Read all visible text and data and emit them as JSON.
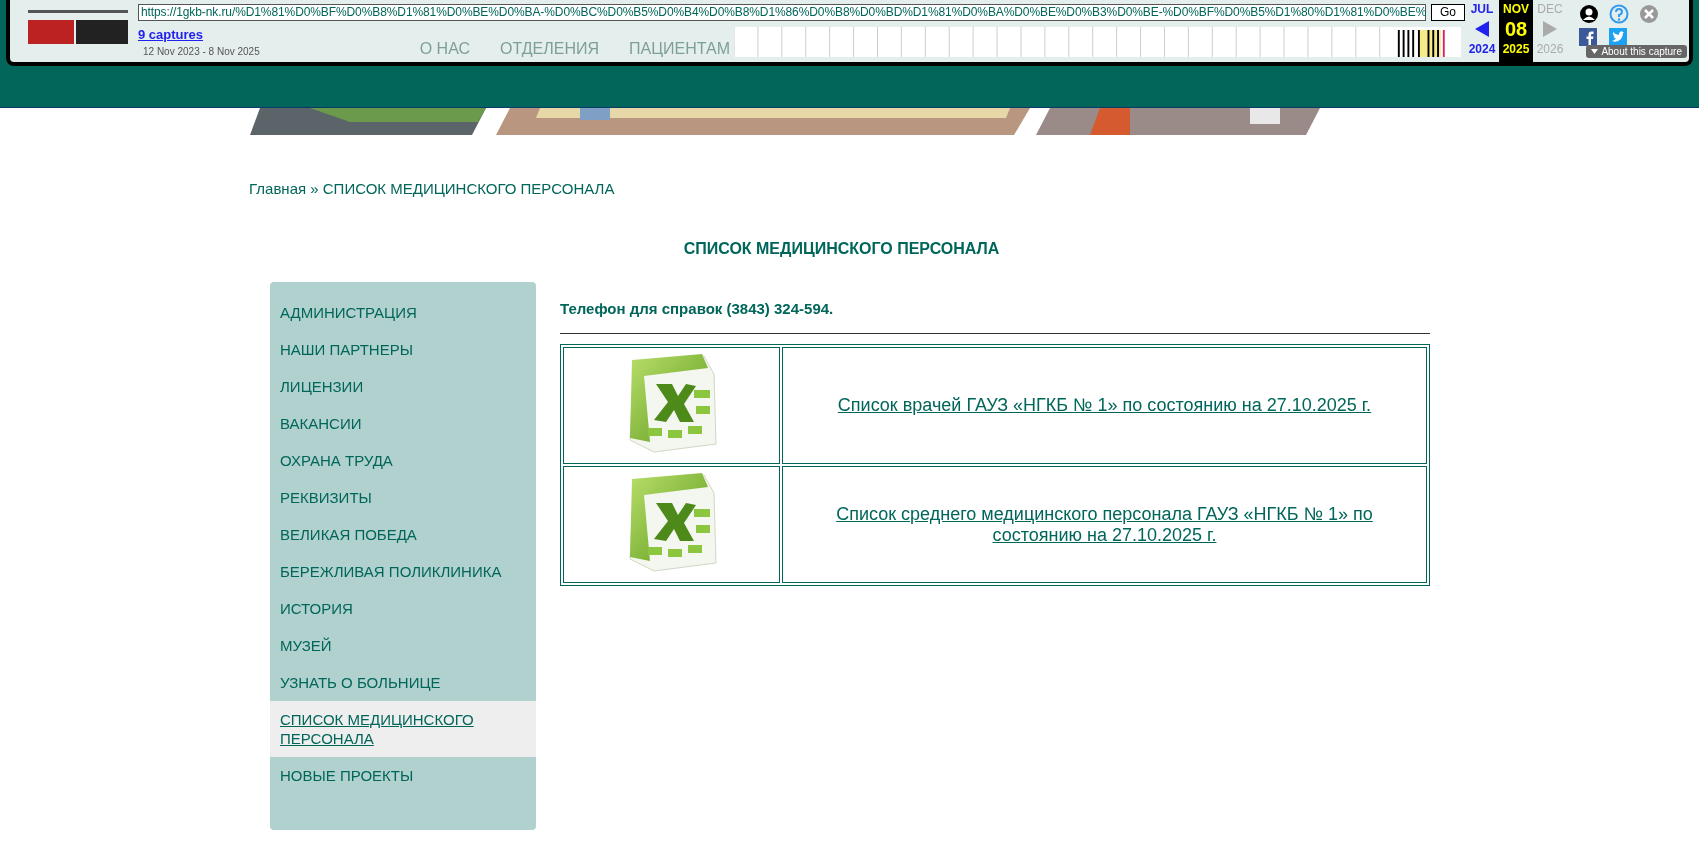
{
  "wayback": {
    "url": "https://1gkb-nk.ru/%D1%81%D0%BF%D0%B8%D1%81%D0%BE%D0%BA-%D0%BC%D0%B5%D0%B4%D0%B8%D1%86%D0%B8%D0%BD%D1%81%D0%BA%D0%BE%D0%B3%D0%BE-%D0%BF%D0%B5%D1%80%D1%81%D0%BE%",
    "go": "Go",
    "captures": "9 captures",
    "range": "12 Nov 2023 - 8 Nov 2025",
    "months": [
      {
        "month": "JUL",
        "year": "2024",
        "selected": false,
        "kind": "prev"
      },
      {
        "month": "NOV",
        "day": "08",
        "year": "2025",
        "selected": true,
        "kind": "current"
      },
      {
        "month": "DEC",
        "year": "2026",
        "selected": false,
        "kind": "next"
      }
    ],
    "about": "About this capture"
  },
  "site_menu": [
    "О НАС",
    "ОТДЕЛЕНИЯ",
    "ПАЦИЕНТАМ"
  ],
  "breadcrumb": {
    "link": "Главная",
    "separator": "»",
    "current": "СПИСОК МЕДИЦИНСКОГО ПЕРСОНАЛА"
  },
  "title": "СПИСОК МЕДИЦИНСКОГО ПЕРСОНАЛА",
  "sidebar": {
    "items": [
      {
        "label": "АДМИНИСТРАЦИЯ",
        "selected": false
      },
      {
        "label": "НАШИ ПАРТНЕРЫ",
        "selected": false
      },
      {
        "label": "ЛИЦЕНЗИИ",
        "selected": false
      },
      {
        "label": "ВАКАНСИИ",
        "selected": false
      },
      {
        "label": "ОХРАНА ТРУДА",
        "selected": false
      },
      {
        "label": "РЕКВИЗИТЫ",
        "selected": false
      },
      {
        "label": "ВЕЛИКАЯ ПОБЕДА",
        "selected": false
      },
      {
        "label": "БЕРЕЖЛИВАЯ ПОЛИКЛИНИКА",
        "selected": false
      },
      {
        "label": "ИСТОРИЯ",
        "selected": false
      },
      {
        "label": "МУЗЕЙ",
        "selected": false
      },
      {
        "label": "УЗНАТЬ О БОЛЬНИЦЕ",
        "selected": false
      },
      {
        "label": "СПИСОК МЕДИЦИНСКОГО ПЕРСОНАЛА",
        "selected": true
      },
      {
        "label": "НОВЫЕ ПРОЕКТЫ",
        "selected": false
      }
    ]
  },
  "phone": "Телефон для справок (3843) 324-594.",
  "documents": [
    {
      "link": "Список врачей ГАУЗ «НГКБ № 1» по состоянию на 27.10.2025 г."
    },
    {
      "link": "Список среднего медицинского персонала ГАУЗ «НГКБ № 1» по состоянию на 27.10.2025 г."
    }
  ]
}
